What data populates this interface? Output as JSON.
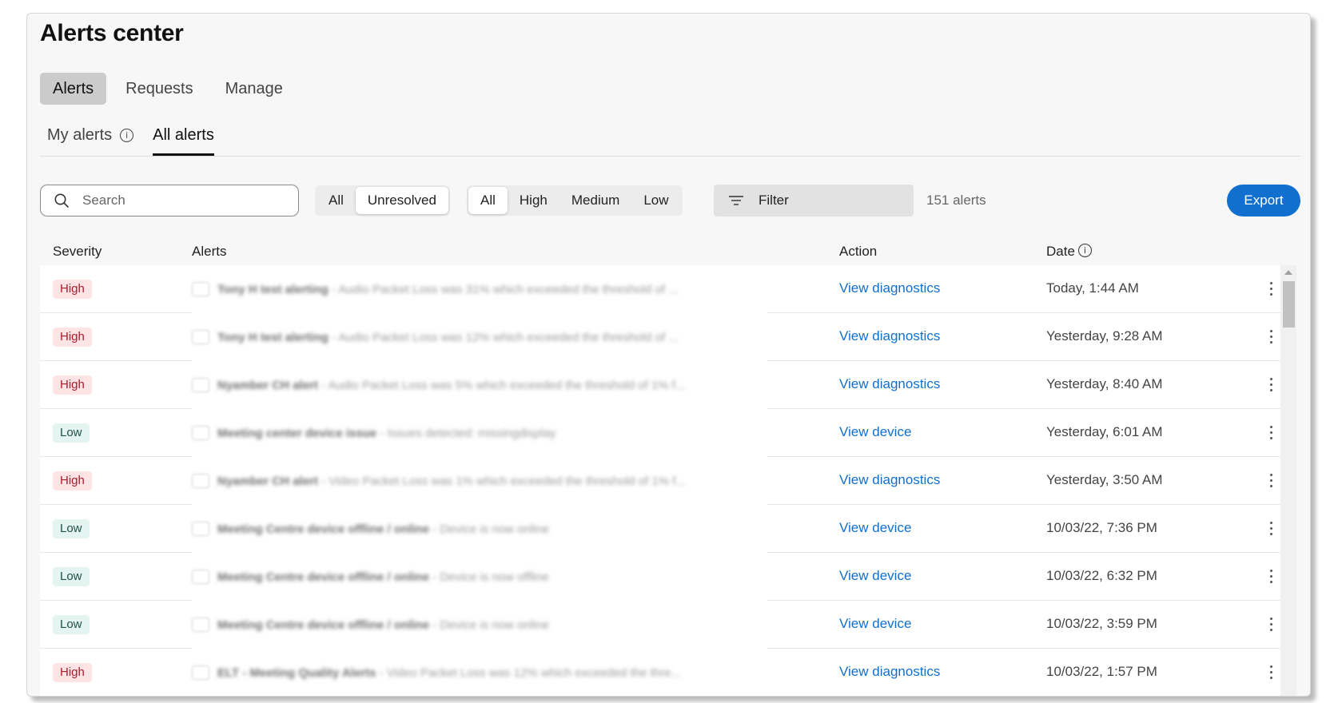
{
  "header": {
    "title": "Alerts center"
  },
  "tabs": [
    {
      "label": "Alerts",
      "active": true
    },
    {
      "label": "Requests",
      "active": false
    },
    {
      "label": "Manage",
      "active": false
    }
  ],
  "subtabs": [
    {
      "label": "My alerts",
      "has_info_icon": true,
      "active": false
    },
    {
      "label": "All alerts",
      "has_info_icon": false,
      "active": true
    }
  ],
  "toolbar": {
    "search_placeholder": "Search",
    "search_value": "",
    "status_options": [
      "All",
      "Unresolved"
    ],
    "status_selected": "Unresolved",
    "severity_options": [
      "All",
      "High",
      "Medium",
      "Low"
    ],
    "severity_selected": "All",
    "filter_label": "Filter",
    "count_label": "151 alerts",
    "export_label": "Export"
  },
  "table": {
    "columns": {
      "severity": "Severity",
      "alerts": "Alerts",
      "action": "Action",
      "date": "Date"
    },
    "rows": [
      {
        "severity": "High",
        "title": "Tony H test alerting",
        "detail": "Audio Packet Loss was 31% which exceeded the threshold of ...",
        "action": "View diagnostics",
        "date": "Today, 1:44 AM"
      },
      {
        "severity": "High",
        "title": "Tony H test alerting",
        "detail": "Audio Packet Loss was 12% which exceeded the threshold of ...",
        "action": "View diagnostics",
        "date": "Yesterday, 9:28 AM"
      },
      {
        "severity": "High",
        "title": "Nyamber CH alert",
        "detail": "Audio Packet Loss was 5% which exceeded the threshold of 1% f...",
        "action": "View diagnostics",
        "date": "Yesterday, 8:40 AM"
      },
      {
        "severity": "Low",
        "title": "Meeting center device issue",
        "detail": "Issues detected: missingdisplay",
        "action": "View device",
        "date": "Yesterday, 6:01 AM"
      },
      {
        "severity": "High",
        "title": "Nyamber CH alert",
        "detail": "Video Packet Loss was 1% which exceeded the threshold of 1% f...",
        "action": "View diagnostics",
        "date": "Yesterday, 3:50 AM"
      },
      {
        "severity": "Low",
        "title": "Meeting Centre device offline / online",
        "detail": "Device is now online",
        "action": "View device",
        "date": "10/03/22, 7:36 PM"
      },
      {
        "severity": "Low",
        "title": "Meeting Centre device offline / online",
        "detail": "Device is now offline",
        "action": "View device",
        "date": "10/03/22, 6:32 PM"
      },
      {
        "severity": "Low",
        "title": "Meeting Centre device offline / online",
        "detail": "Device is now online",
        "action": "View device",
        "date": "10/03/22, 3:59 PM"
      },
      {
        "severity": "High",
        "title": "ELT - Meeting Quality Alerts",
        "detail": "Video Packet Loss was 12% which exceeded the thre...",
        "action": "View diagnostics",
        "date": "10/03/22, 1:57 PM"
      }
    ]
  },
  "colors": {
    "accent": "#1170cf",
    "high_badge_bg": "#ffe4e6",
    "high_badge_text": "#b3192a",
    "low_badge_bg": "#e4f5f1",
    "low_badge_text": "#1f4f48"
  },
  "icons": {
    "search": "search-icon",
    "filter": "filter-icon",
    "info": "info-icon",
    "row_menu": "kebab-menu-icon",
    "device": "device-icon"
  }
}
